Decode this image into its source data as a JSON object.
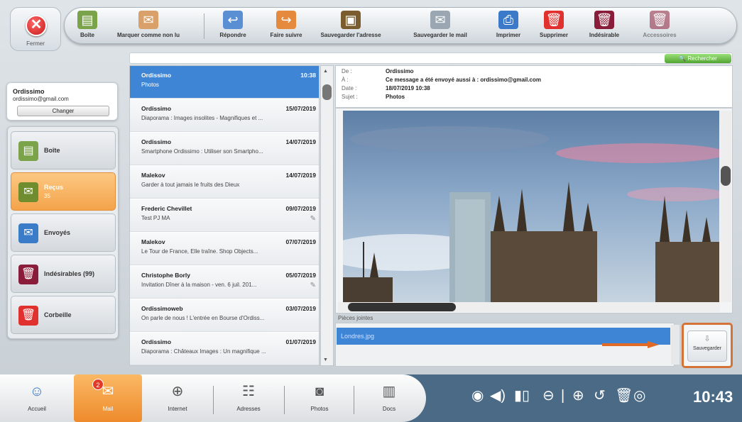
{
  "close_button": {
    "label": "Fermer"
  },
  "toolbar": {
    "items": [
      {
        "label": "Boîte",
        "icon": "inbox-icon"
      },
      {
        "label": "Marquer comme non lu",
        "icon": "mark-unread-icon"
      },
      {
        "label": "Répondre",
        "icon": "reply-icon"
      },
      {
        "label": "Faire suivre",
        "icon": "forward-icon"
      },
      {
        "label": "Sauvegarder l'adresse",
        "icon": "save-address-icon"
      },
      {
        "label": "Sauvegarder le mail",
        "icon": "save-mail-icon"
      },
      {
        "label": "Imprimer",
        "icon": "printer-icon"
      },
      {
        "label": "Supprimer",
        "icon": "trash-icon"
      },
      {
        "label": "Indésirable",
        "icon": "spam-icon"
      },
      {
        "label": "Accessoires",
        "icon": "accessories-icon"
      }
    ]
  },
  "search": {
    "label": "🔍 Rechercher"
  },
  "account": {
    "name": "Ordissimo",
    "email": "ordissimo@gmail.com",
    "change_label": "Changer"
  },
  "folders": [
    {
      "label": "Boîte",
      "icon": "mailbox-icon",
      "sub": ""
    },
    {
      "label": "Reçus",
      "icon": "received-icon",
      "sub": "35"
    },
    {
      "label": "Envoyés",
      "icon": "sent-icon",
      "sub": ""
    },
    {
      "label": "Indésirables (99)",
      "icon": "spam-folder-icon",
      "sub": ""
    },
    {
      "label": "Corbeille",
      "icon": "trash-folder-icon",
      "sub": ""
    }
  ],
  "messages": [
    {
      "sender": "Ordissimo",
      "date": "10:38",
      "preview": "Photos",
      "attachment": true
    },
    {
      "sender": "Ordissimo",
      "date": "15/07/2019",
      "preview": "Diaporama : Images insolites - Magnifiques et ...",
      "attachment": false
    },
    {
      "sender": "Ordissimo",
      "date": "14/07/2019",
      "preview": "Smartphone Ordissimo : Utiliser son Smartpho...",
      "attachment": false
    },
    {
      "sender": "Malekov",
      "date": "14/07/2019",
      "preview": "Garder à tout jamais le fruits des Dieux",
      "attachment": false
    },
    {
      "sender": "Frederic Chevillet",
      "date": "09/07/2019",
      "preview": "Test PJ MA",
      "attachment": true
    },
    {
      "sender": "Malekov",
      "date": "07/07/2019",
      "preview": "Le Tour de France, Elle traîne. Shop Objects...",
      "attachment": false
    },
    {
      "sender": "Christophe Borly",
      "date": "05/07/2019",
      "preview": "Invitation Dîner à la maison - ven. 6 juil. 201...",
      "attachment": true
    },
    {
      "sender": "Ordissimoweb",
      "date": "03/07/2019",
      "preview": "On parle de nous ! L'entrée en Bourse d'Ordiss...",
      "attachment": false
    },
    {
      "sender": "Ordissimo",
      "date": "01/07/2019",
      "preview": "Diaporama : Châteaux Images : Un magnifique ...",
      "attachment": false
    }
  ],
  "header": {
    "from_label": "De :",
    "from": "Ordissimo",
    "to_label": "À :",
    "to": "Ce message a été envoyé aussi à : ordissimo@gmail.com",
    "date_label": "Date :",
    "date": "18/07/2019 10:38",
    "subject_label": "Sujet :",
    "subject": "Photos"
  },
  "attachments": {
    "label": "Pièces jointes",
    "file": "Londres.jpg",
    "save_label": "Sauvegarder"
  },
  "dock": [
    {
      "label": "Accueil",
      "icon": "home-icon"
    },
    {
      "label": "Mail",
      "icon": "mail-icon"
    },
    {
      "label": "Internet",
      "icon": "globe-icon"
    },
    {
      "label": "Adresses",
      "icon": "contacts-icon"
    },
    {
      "label": "Photos",
      "icon": "camera-icon"
    },
    {
      "label": "Docs",
      "icon": "documents-icon"
    }
  ],
  "mail_badge": "2",
  "status": {
    "time": "10:43"
  },
  "colors": {
    "accent": "#f4a34a",
    "selection": "#3f85d6",
    "taskbar": "#4a6a86"
  }
}
